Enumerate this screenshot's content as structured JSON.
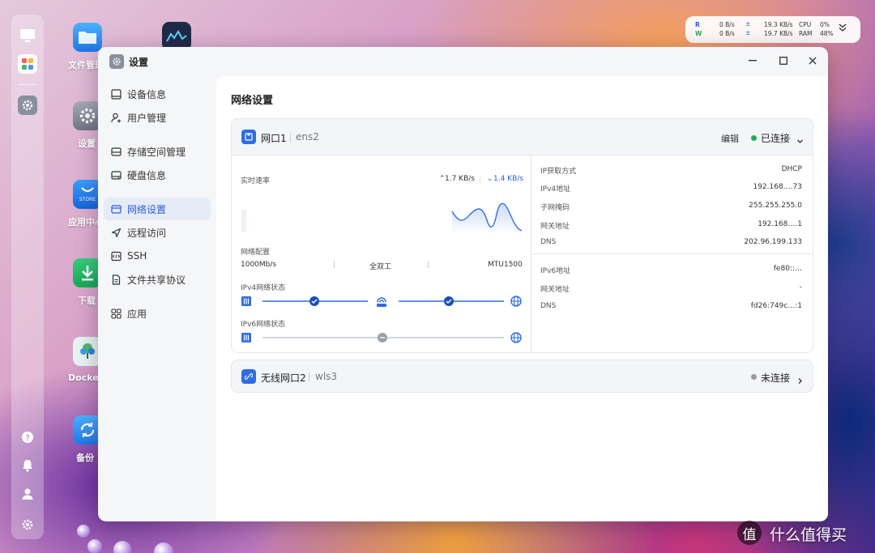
{
  "dock": {
    "items": [
      "monitor-icon",
      "apps-icon",
      "settings-icon",
      "help-icon",
      "bell-icon",
      "user-icon",
      "gear-icon"
    ]
  },
  "desktop": [
    {
      "label": "文件管理",
      "icon": "folder-icon"
    },
    {
      "label": "设置",
      "icon": "settings-icon"
    },
    {
      "label": "应用中心",
      "icon": "store-icon"
    },
    {
      "label": "下载",
      "icon": "download-icon"
    },
    {
      "label": "Docker",
      "icon": "docker-icon"
    },
    {
      "label": "备份",
      "icon": "backup-icon"
    }
  ],
  "monitor": {
    "r_label": "R",
    "w_label": "W",
    "r_speed": "0  B/s",
    "w_speed": "0  B/s",
    "up_r": "19.3 KB/s",
    "up_w": "19.7 KB/s",
    "cpu_label": "CPU",
    "cpu_val": "0%",
    "ram_label": "RAM",
    "ram_val": "48%"
  },
  "window": {
    "title": "设置",
    "min": "–",
    "max": "□",
    "close": "✕"
  },
  "sidebar": [
    {
      "label": "设备信息",
      "icon": "device-info-icon"
    },
    {
      "label": "用户管理",
      "icon": "user-icon"
    },
    {
      "label": "存储空间管理",
      "icon": "storage-icon"
    },
    {
      "label": "硬盘信息",
      "icon": "disk-icon"
    },
    {
      "label": "网络设置",
      "icon": "network-icon",
      "active": true
    },
    {
      "label": "远程访问",
      "icon": "remote-icon"
    },
    {
      "label": "SSH",
      "icon": "ssh-icon"
    },
    {
      "label": "文件共享协议",
      "icon": "file-share-icon"
    },
    {
      "label": "应用",
      "icon": "apps-icon"
    }
  ],
  "page": {
    "title": "网络设置"
  },
  "port1": {
    "name": "网口1",
    "iface": "ens2",
    "edit": "编辑",
    "status": "已连接",
    "status_color": "#22b04a",
    "rate_label": "实时速率",
    "up_rate": "1.7 KB/s",
    "down_rate": "1.4 KB/s",
    "config_label": "网络配置",
    "speed": "1000Mb/s",
    "duplex": "全双工",
    "mtu": "MTU1500",
    "ipv4_status": "IPv4网络状态",
    "ipv6_status": "IPv6网络状态",
    "info": [
      {
        "k": "IP获取方式",
        "v": "DHCP"
      },
      {
        "k": "IPv4地址",
        "v": "192.168.…73"
      },
      {
        "k": "子网掩码",
        "v": "255.255.255.0"
      },
      {
        "k": "网关地址",
        "v": "192.168.…1"
      },
      {
        "k": "DNS",
        "v": "202.96.199.133"
      }
    ],
    "info6": [
      {
        "k": "IPv6地址",
        "v": "fe80::…"
      },
      {
        "k": "网关地址",
        "v": "-"
      },
      {
        "k": "DNS",
        "v": "fd26:749c…:1"
      }
    ]
  },
  "port2": {
    "name": "无线网口2",
    "iface": "wls3",
    "status": "未连接",
    "status_color": "#999999"
  },
  "accent": "#2f6de3",
  "watermark": "值 什么值得买"
}
